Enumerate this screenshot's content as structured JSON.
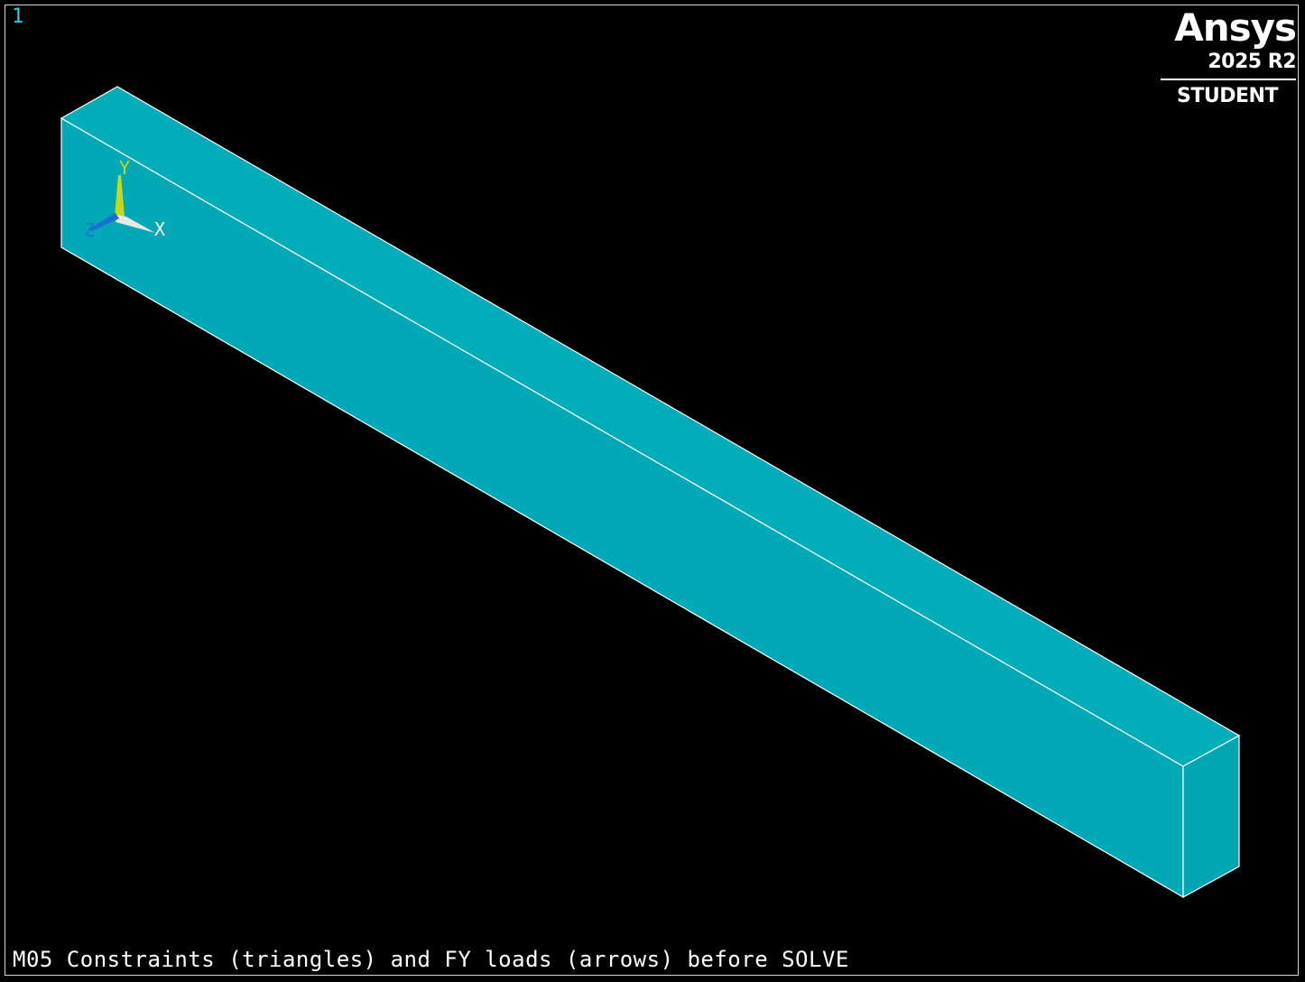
{
  "viewer": {
    "window_number": "1",
    "caption": "M05 Constraints (triangles) and FY loads (arrows) before SOLVE"
  },
  "logo": {
    "brand": "Ansys",
    "version": "2025 R2",
    "edition": "STUDENT"
  },
  "triad": {
    "x_label": "X",
    "y_label": "Y",
    "z_label": "Z"
  },
  "colors": {
    "background": "#000000",
    "model_fill": "#00a9b5",
    "model_edges": "#ffffff",
    "window_number": "#1fd1d9",
    "y_axis": "#c6d81c",
    "x_axis": "#ffffff",
    "z_axis": "#1a6fd6"
  }
}
